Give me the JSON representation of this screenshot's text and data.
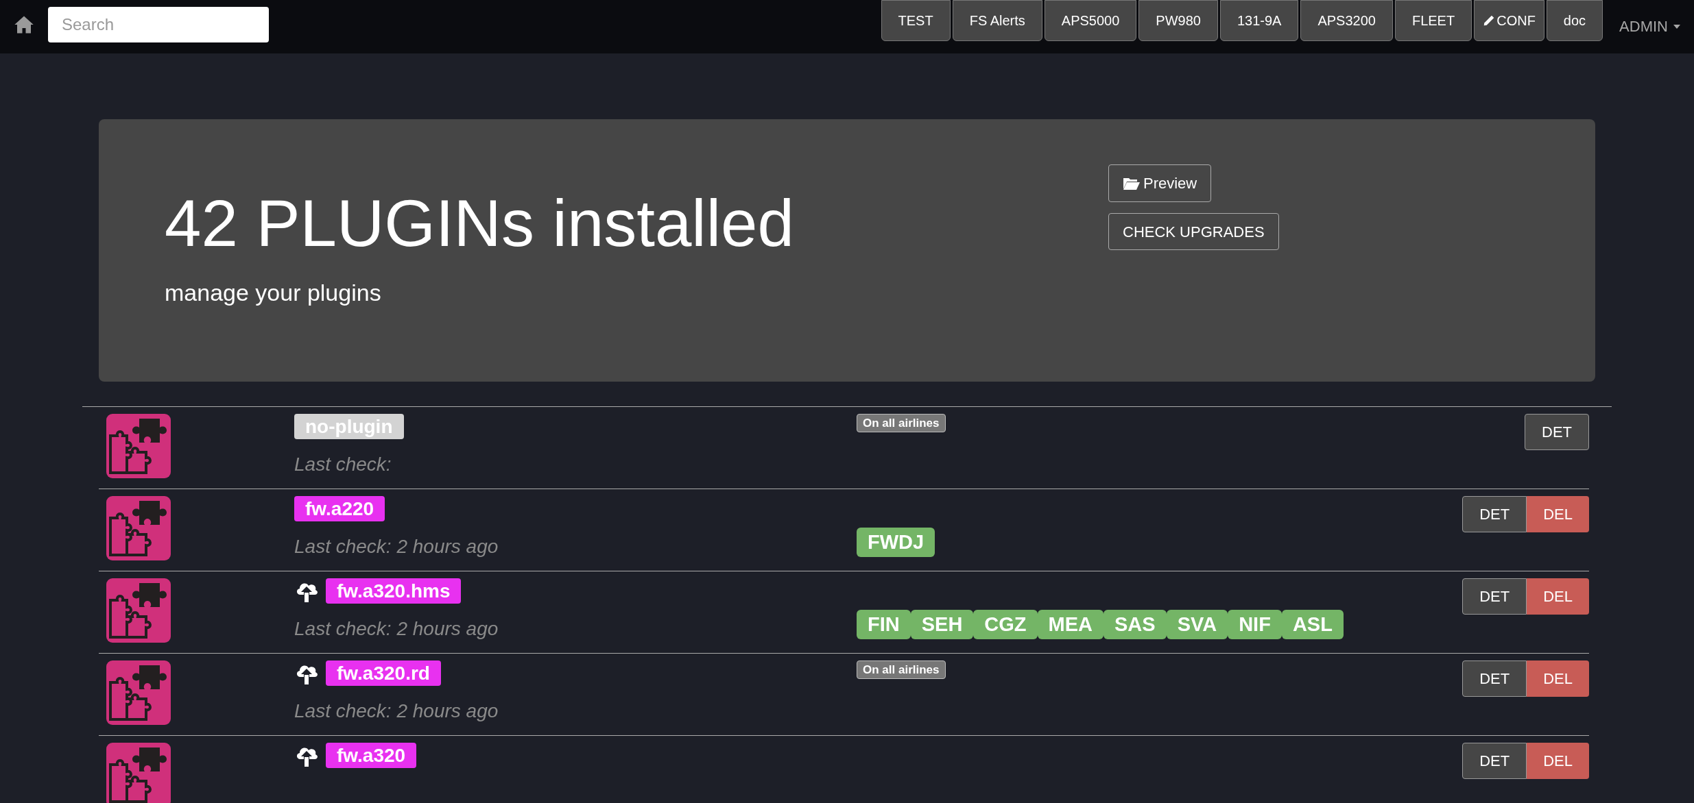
{
  "navbar": {
    "search": {
      "placeholder": "Search"
    },
    "buttons": [
      {
        "label": "TEST",
        "kind": "plain"
      },
      {
        "label": "FS Alerts",
        "kind": "plain"
      },
      {
        "label": "APS5000",
        "kind": "plain"
      },
      {
        "label": "PW980",
        "kind": "plain"
      },
      {
        "label": "131-9A",
        "kind": "plain"
      },
      {
        "label": "APS3200",
        "kind": "plain"
      },
      {
        "label": "FLEET",
        "kind": "plain"
      },
      {
        "label": "CONF",
        "kind": "edit"
      },
      {
        "label": "doc",
        "kind": "plain"
      }
    ],
    "user_menu": "ADMIN"
  },
  "hero": {
    "title": "42 PLUGINs installed",
    "subtitle": "manage your plugins",
    "buttons": [
      {
        "label": "Preview",
        "kind": "folder"
      },
      {
        "label": "CHECK UPGRADES",
        "kind": "plain"
      }
    ]
  },
  "plugins": [
    {
      "name": "no-plugin",
      "color": "#d3d3d3",
      "upgrade_available": false,
      "last_check": "Last check:",
      "airlines": {
        "kind": "all",
        "label": "On all airlines"
      },
      "actions": [
        {
          "label": "DET",
          "kind": "details"
        }
      ]
    },
    {
      "name": "fw.a220",
      "color": "#e831f0",
      "upgrade_available": false,
      "last_check": "Last check: 2 hours ago",
      "airlines": {
        "kind": "list",
        "tags": [
          "FWDJ"
        ]
      },
      "actions": [
        {
          "label": "DET",
          "kind": "details"
        },
        {
          "label": "DEL",
          "kind": "delete"
        }
      ]
    },
    {
      "name": "fw.a320.hms",
      "color": "#e831f0",
      "upgrade_available": true,
      "last_check": "Last check: 2 hours ago",
      "airlines": {
        "kind": "list",
        "tags": [
          "FIN",
          "SEH",
          "CGZ",
          "MEA",
          "SAS",
          "SVA",
          "NIF",
          "ASL"
        ]
      },
      "actions": [
        {
          "label": "DET",
          "kind": "details"
        },
        {
          "label": "DEL",
          "kind": "delete"
        }
      ]
    },
    {
      "name": "fw.a320.rd",
      "color": "#e831f0",
      "upgrade_available": true,
      "last_check": "Last check: 2 hours ago",
      "airlines": {
        "kind": "all",
        "label": "On all airlines"
      },
      "actions": [
        {
          "label": "DET",
          "kind": "details"
        },
        {
          "label": "DEL",
          "kind": "delete"
        }
      ]
    },
    {
      "name": "fw.a320",
      "color": "#e831f0",
      "upgrade_available": true,
      "actions": [
        {
          "label": "DET",
          "kind": "details"
        },
        {
          "label": "DEL",
          "kind": "delete"
        }
      ]
    }
  ]
}
